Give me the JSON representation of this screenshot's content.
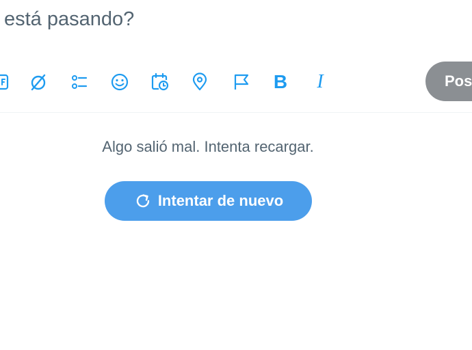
{
  "compose": {
    "placeholder": "está pasando?"
  },
  "toolbar": {
    "icons": [
      "gif-icon",
      "grok-icon",
      "poll-icon",
      "emoji-icon",
      "schedule-icon",
      "location-icon",
      "flag-icon",
      "bold-icon",
      "italic-icon"
    ],
    "bold_glyph": "B",
    "italic_glyph": "I",
    "post_label": "Pos",
    "accent_color": "#1d9bf0",
    "post_disabled_color": "#8b8f93"
  },
  "error": {
    "message": "Algo salió mal. Intenta recargar.",
    "retry_label": "Intentar de nuevo",
    "retry_icon": "refresh-icon",
    "button_color": "#4c9eeb"
  }
}
